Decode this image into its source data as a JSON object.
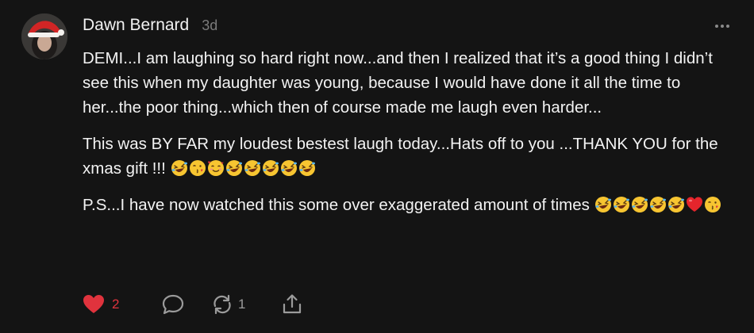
{
  "comment": {
    "author": "Dawn Bernard",
    "timestamp": "3d",
    "paragraphs": [
      "DEMI...I am laughing so hard right now...and then I realized that it’s a good thing I didn’t see this when my daughter was young, because I would have done it all the time to her...the poor thing...which then of course made me laugh even harder...",
      "This was BY FAR my loudest bestest laugh today...Hats off to you ...THANK YOU for the xmas gift !!! ",
      "P.S...I have now watched this some over exaggerated amount of times "
    ],
    "paragraph_emojis": [
      [],
      [
        "rolling-laughing-emoji",
        "kissing-heart-emoji",
        "smiling-hearts-emoji",
        "rolling-laughing-emoji",
        "rolling-laughing-emoji",
        "rolling-laughing-emoji",
        "rolling-laughing-emoji",
        "rolling-laughing-emoji"
      ],
      [
        "rolling-laughing-emoji",
        "rolling-laughing-emoji",
        "rolling-laughing-emoji",
        "rolling-laughing-emoji",
        "rolling-laughing-emoji",
        "red-heart-emoji",
        "kissing-heart-emoji"
      ]
    ]
  },
  "actions": {
    "like_count": "2",
    "restack_count": "1",
    "liked": true
  },
  "icons": {
    "avatar": "avatar-santa-hat",
    "more": "more-dots-icon",
    "like": "heart-icon",
    "reply": "speech-bubble-icon",
    "restack": "restack-icon",
    "share": "share-icon"
  },
  "colors": {
    "background": "#141414",
    "text": "#f3f3f3",
    "muted": "#7b7b7b",
    "like": "#e0333d"
  }
}
